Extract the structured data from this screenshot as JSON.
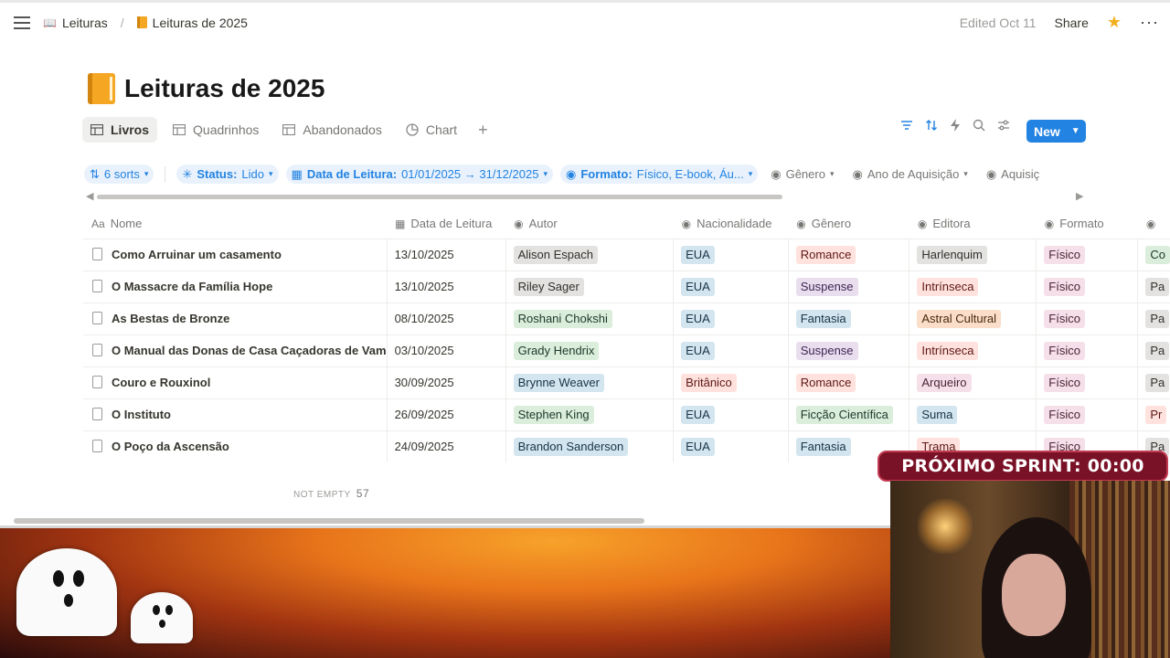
{
  "topbar": {
    "breadcrumb_parent": "Leituras",
    "breadcrumb_current": "Leituras de 2025",
    "edited": "Edited Oct 11",
    "share": "Share"
  },
  "page": {
    "title": "Leituras de 2025"
  },
  "views": [
    {
      "label": "Livros",
      "icon": "table-icon"
    },
    {
      "label": "Quadrinhos",
      "icon": "table-icon"
    },
    {
      "label": "Abandonados",
      "icon": "table-icon"
    },
    {
      "label": "Chart",
      "icon": "chart-icon"
    }
  ],
  "new_button": "New",
  "filters": {
    "sorts": "6 sorts",
    "status_label": "Status:",
    "status_value": "Lido",
    "date_label": "Data de Leitura:",
    "date_value": "01/01/2025 → 31/12/2025",
    "format_label": "Formato:",
    "format_value": "Físico, E-book, Áu...",
    "genre": "Gênero",
    "year": "Ano de Aquisição",
    "acq": "Aquisiç"
  },
  "table": {
    "columns": [
      "Nome",
      "Data de Leitura",
      "Autor",
      "Nacionalidade",
      "Gênero",
      "Editora",
      "Formato"
    ],
    "rows": [
      {
        "nome": "Como Arruinar um casamento",
        "data": "13/10/2025",
        "autor": "Alison Espach",
        "nac": "EUA",
        "genero": "Romance",
        "editora": "Harlenquim",
        "formato": "Físico",
        "extra": "Co"
      },
      {
        "nome": "O Massacre da Família Hope",
        "data": "13/10/2025",
        "autor": "Riley Sager",
        "nac": "EUA",
        "genero": "Suspense",
        "editora": "Intrínseca",
        "formato": "Físico",
        "extra": "Pa"
      },
      {
        "nome": "As Bestas de Bronze",
        "data": "08/10/2025",
        "autor": "Roshani Chokshi",
        "nac": "EUA",
        "genero": "Fantasia",
        "editora": "Astral Cultural",
        "formato": "Físico",
        "extra": "Pa"
      },
      {
        "nome": "O Manual das Donas de Casa Caçadoras de Vam",
        "data": "03/10/2025",
        "autor": "Grady Hendrix",
        "nac": "EUA",
        "genero": "Suspense",
        "editora": "Intrínseca",
        "formato": "Físico",
        "extra": "Pa"
      },
      {
        "nome": "Couro e Rouxinol",
        "data": "30/09/2025",
        "autor": "Brynne Weaver",
        "nac": "Britânico",
        "genero": "Romance",
        "editora": "Arqueiro",
        "formato": "Físico",
        "extra": "Pa"
      },
      {
        "nome": "O Instituto",
        "data": "26/09/2025",
        "autor": "Stephen King",
        "nac": "EUA",
        "genero": "Ficção Científica",
        "editora": "Suma",
        "formato": "Físico",
        "extra": "Pr"
      },
      {
        "nome": "O Poço da Ascensão",
        "data": "24/09/2025",
        "autor": "Brandon Sanderson",
        "nac": "EUA",
        "genero": "Fantasia",
        "editora": "Trama",
        "formato": "Físico",
        "extra": "Pa"
      }
    ]
  },
  "footer": {
    "label": "NOT EMPTY",
    "count": "57"
  },
  "overlay": {
    "sprint": "PRÓXIMO SPRINT: 00:00"
  }
}
